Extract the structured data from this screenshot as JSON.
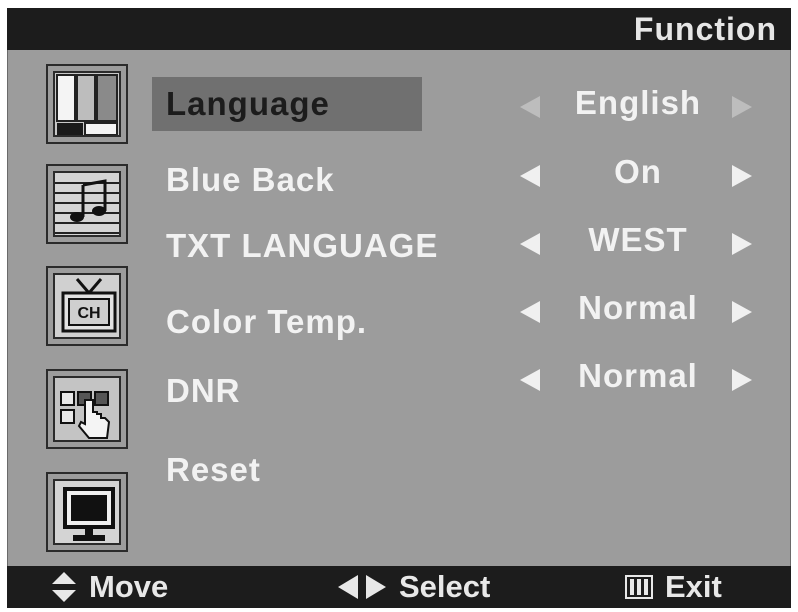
{
  "header": {
    "title": "Function"
  },
  "sidebar": {
    "icons": [
      {
        "name": "picture-icon"
      },
      {
        "name": "sound-icon"
      },
      {
        "name": "channel-icon"
      },
      {
        "name": "function-icon"
      },
      {
        "name": "screen-icon",
        "label": ""
      },
      {
        "ch_label": "CH"
      }
    ]
  },
  "menu": {
    "items": [
      {
        "label": "Language",
        "value": "English",
        "selected": true
      },
      {
        "label": "Blue  Back",
        "value": "On"
      },
      {
        "label": "TXT LANGUAGE",
        "value": "WEST"
      },
      {
        "label": "Color Temp.",
        "value": "Normal"
      },
      {
        "label": "DNR",
        "value": "Normal"
      },
      {
        "label": "Reset"
      }
    ]
  },
  "footer": {
    "move_label": "Move",
    "select_label": "Select",
    "exit_label": "Exit"
  },
  "colors": {
    "panel": "#9c9c9c",
    "bar": "#1c1c1c",
    "highlight": "#707070",
    "text": "#f2f2f2"
  }
}
